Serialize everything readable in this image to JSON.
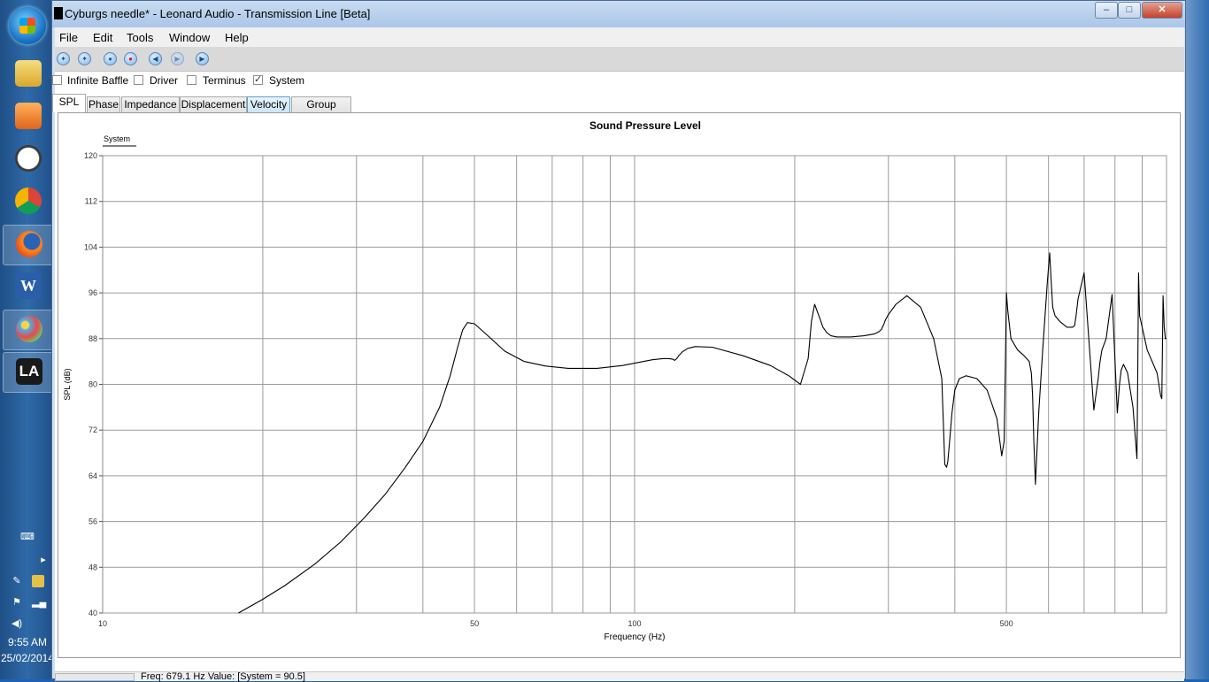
{
  "window": {
    "title": "Cyburgs needle* - Leonard Audio - Transmission Line [Beta]",
    "controls": {
      "minimize": "‒",
      "maximize": "□",
      "close": "✕"
    }
  },
  "menu": [
    "File",
    "Edit",
    "Tools",
    "Window",
    "Help"
  ],
  "toolbar": [
    "new-icon",
    "open-icon",
    "save-icon",
    "record-icon",
    "back-icon",
    "forward-icon",
    "play-icon"
  ],
  "checkboxes": [
    {
      "label": "Infinite Baffle",
      "checked": false
    },
    {
      "label": "Driver",
      "checked": false
    },
    {
      "label": "Terminus",
      "checked": false
    },
    {
      "label": "System",
      "checked": true
    }
  ],
  "tabs": [
    {
      "label": "SPL",
      "selected": true
    },
    {
      "label": "Phase",
      "selected": false
    },
    {
      "label": "Impedance",
      "selected": false
    },
    {
      "label": "Displacement",
      "selected": false
    },
    {
      "label": "Velocity",
      "selected": false,
      "hover": true
    },
    {
      "label": "Group Delay",
      "selected": false
    }
  ],
  "chart_data": {
    "type": "line",
    "title": "Sound Pressure Level",
    "legend": "System",
    "legend_position": "top-left",
    "xlabel": "Frequency (Hz)",
    "ylabel": "SPL (dB)",
    "x_scale": "log",
    "xlim": [
      10,
      1000
    ],
    "ylim": [
      40,
      120
    ],
    "x_tick_labels": [
      {
        "value": 10,
        "label": "10"
      },
      {
        "value": 50,
        "label": "50"
      },
      {
        "value": 100,
        "label": "100"
      },
      {
        "value": 500,
        "label": "500"
      }
    ],
    "x_gridlines": [
      20,
      30,
      40,
      50,
      60,
      70,
      80,
      90,
      100,
      200,
      300,
      400,
      500,
      600,
      700,
      800,
      900,
      1000
    ],
    "y_ticks": [
      40,
      48,
      56,
      64,
      72,
      80,
      88,
      96,
      104,
      112,
      120
    ],
    "grid": true,
    "series": [
      {
        "name": "System",
        "x": [
          18,
          20,
          22,
          25,
          28,
          31,
          34,
          37,
          40,
          43,
          45,
          46.5,
          47.5,
          48.5,
          50,
          53,
          57,
          62,
          68,
          75,
          85,
          95,
          100,
          108,
          113,
          116,
          118,
          119,
          120,
          121,
          123,
          126,
          130,
          140,
          160,
          180,
          195,
          205,
          212,
          215,
          218,
          222,
          226,
          230,
          234,
          240,
          255,
          270,
          282,
          288,
          291,
          293,
          294.5,
          296,
          300,
          310,
          325,
          345,
          365,
          378,
          383,
          386,
          388,
          391,
          395,
          400,
          408,
          420,
          440,
          460,
          480,
          490,
          495,
          498,
          500,
          503,
          510,
          525,
          540,
          552,
          557,
          560,
          563,
          567,
          575,
          585,
          597,
          603,
          607,
          611,
          617,
          630,
          650,
          666,
          672,
          676,
          682,
          700,
          730,
          744,
          750,
          756,
          770,
          790,
          808,
          816,
          822,
          830,
          845,
          865,
          880,
          883,
          886,
          890,
          920,
          960,
          975,
          980,
          985,
          990,
          995,
          1000
        ],
        "y": [
          40,
          42.4,
          44.8,
          48.5,
          52.4,
          56.6,
          60.8,
          65.4,
          70,
          76,
          81.5,
          86.5,
          89.5,
          90.8,
          90.6,
          88.5,
          85.8,
          84,
          83.2,
          82.8,
          82.8,
          83.3,
          83.7,
          84.3,
          84.5,
          84.5,
          84.4,
          84.2,
          84.5,
          85,
          85.7,
          86.3,
          86.6,
          86.5,
          85,
          83.3,
          81.5,
          80,
          84.5,
          91,
          94,
          92,
          90,
          89,
          88.5,
          88.3,
          88.3,
          88.5,
          88.8,
          89.2,
          89.6,
          90.2,
          90.6,
          91.2,
          92.2,
          94,
          95.5,
          93.5,
          88,
          81,
          66,
          65.5,
          66.5,
          70,
          75,
          79,
          81,
          81.5,
          81,
          79,
          74,
          67.5,
          70,
          84,
          96,
          93,
          88,
          86,
          85,
          84,
          82,
          78,
          70,
          62.5,
          75,
          86,
          98,
          103,
          98,
          93.5,
          92,
          91,
          90,
          90,
          90.3,
          92,
          95,
          99.5,
          75.5,
          81,
          84,
          86,
          88,
          95.7,
          75,
          80,
          82.5,
          83.5,
          82,
          76,
          67,
          82,
          99.5,
          92,
          86,
          82,
          78,
          77.5,
          95.5,
          90,
          88,
          88
        ]
      }
    ]
  },
  "status": {
    "text": "Freq: 679.1 Hz   Value: [System = 90.5]"
  },
  "system_tray": {
    "time": "9:55 AM",
    "date": "25/02/2014"
  },
  "taskbar_apps": [
    "start-orb-icon",
    "file-explorer-icon",
    "media-player-icon",
    "clock-icon",
    "chrome-icon",
    "firefox-icon",
    "word-icon",
    "paint-icon",
    "leonard-audio-icon"
  ]
}
